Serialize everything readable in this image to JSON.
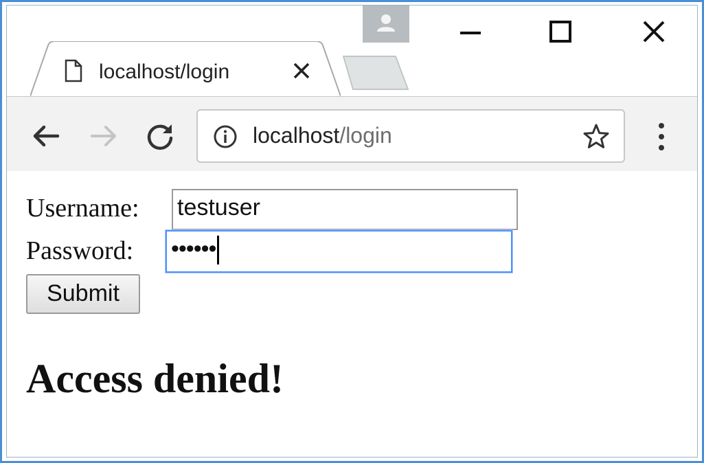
{
  "window": {
    "controls": {
      "profile_icon": "person-icon",
      "minimize_icon": "minimize-icon",
      "maximize_icon": "maximize-icon",
      "close_icon": "close-icon"
    }
  },
  "tab": {
    "title": "localhost/login",
    "page_icon": "page-icon",
    "close_icon": "close-icon"
  },
  "toolbar": {
    "back_icon": "back-arrow-icon",
    "forward_icon": "forward-arrow-icon",
    "reload_icon": "reload-icon",
    "address": {
      "host": "localhost",
      "path": "/login",
      "info_icon": "info-icon",
      "bookmark_icon": "star-icon"
    },
    "menu_icon": "kebab-menu-icon"
  },
  "form": {
    "username_label": "Username:",
    "username_value": "testuser",
    "password_label": "Password:",
    "password_value": "••••••",
    "submit_label": "Submit"
  },
  "message": "Access denied!",
  "colors": {
    "focus_border": "#4d90fe",
    "window_border": "#4a8fd6"
  }
}
